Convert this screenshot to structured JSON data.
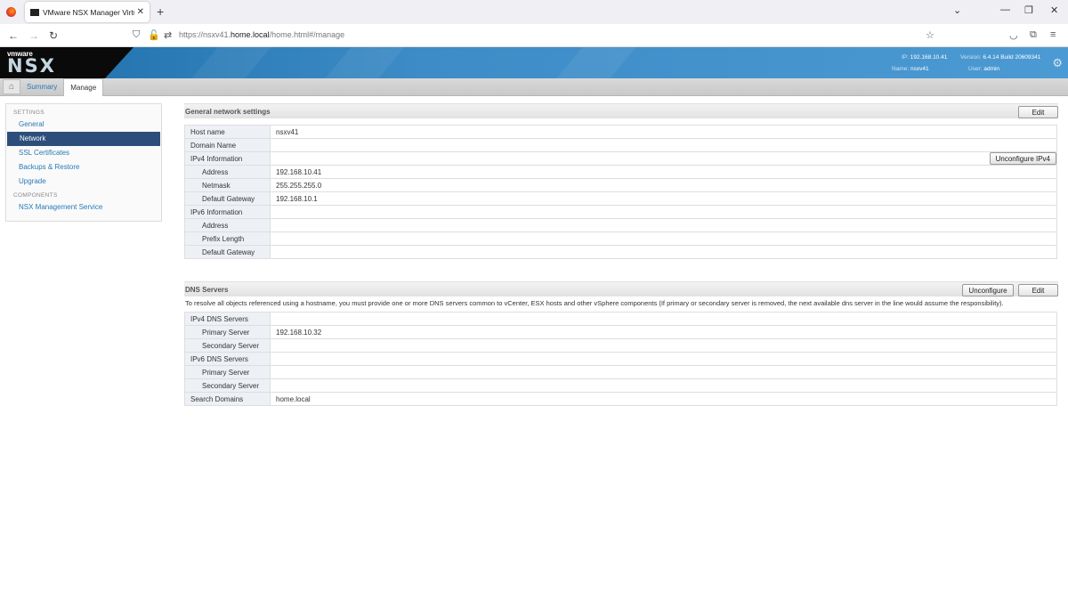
{
  "browser": {
    "tab_title": "VMware NSX Manager Virtual A",
    "url_prefix": "https://nsxv41.",
    "url_host": "home.local",
    "url_path": "/home.html#/manage"
  },
  "header": {
    "brand": "vmware",
    "product": "NSX",
    "ip_label": "IP:",
    "ip_value": "192.168.10.41",
    "version_label": "Version:",
    "version_value": "6.4.14 Build 20609341",
    "name_label": "Name:",
    "name_value": "nsxv41",
    "user_label": "User:",
    "user_value": "admin"
  },
  "tabs": {
    "summary": "Summary",
    "manage": "Manage"
  },
  "sidebar": {
    "settings_heading": "SETTINGS",
    "items": [
      "General",
      "Network",
      "SSL Certificates",
      "Backups & Restore",
      "Upgrade"
    ],
    "components_heading": "COMPONENTS",
    "component_items": [
      "NSX Management Service"
    ]
  },
  "general": {
    "title": "General network settings",
    "edit": "Edit",
    "unconfigure_ipv4": "Unconfigure IPv4",
    "rows": [
      {
        "label": "Host name",
        "value": "nsxv41"
      },
      {
        "label": "Domain Name",
        "value": ""
      },
      {
        "label": "IPv4 Information",
        "value": ""
      },
      {
        "label": "Address",
        "value": "192.168.10.41"
      },
      {
        "label": "Netmask",
        "value": "255.255.255.0"
      },
      {
        "label": "Default Gateway",
        "value": "192.168.10.1"
      },
      {
        "label": "IPv6 Information",
        "value": ""
      },
      {
        "label": "Address",
        "value": ""
      },
      {
        "label": "Prefix Length",
        "value": ""
      },
      {
        "label": "Default Gateway",
        "value": ""
      }
    ]
  },
  "dns": {
    "title": "DNS Servers",
    "unconfigure": "Unconfigure",
    "edit": "Edit",
    "description": "To resolve all objects referenced using a hostname, you must provide one or more DNS servers common to vCenter, ESX hosts and other vSphere components (If primary or secondary server is removed, the next available dns server in the line would assume the responsibility).",
    "rows": [
      {
        "label": "IPv4 DNS Servers",
        "value": ""
      },
      {
        "label": "Primary Server",
        "value": "192.168.10.32"
      },
      {
        "label": "Secondary Server",
        "value": ""
      },
      {
        "label": "IPv6 DNS Servers",
        "value": ""
      },
      {
        "label": "Primary Server",
        "value": ""
      },
      {
        "label": "Secondary Server",
        "value": ""
      },
      {
        "label": "Search Domains",
        "value": "home.local"
      }
    ]
  }
}
